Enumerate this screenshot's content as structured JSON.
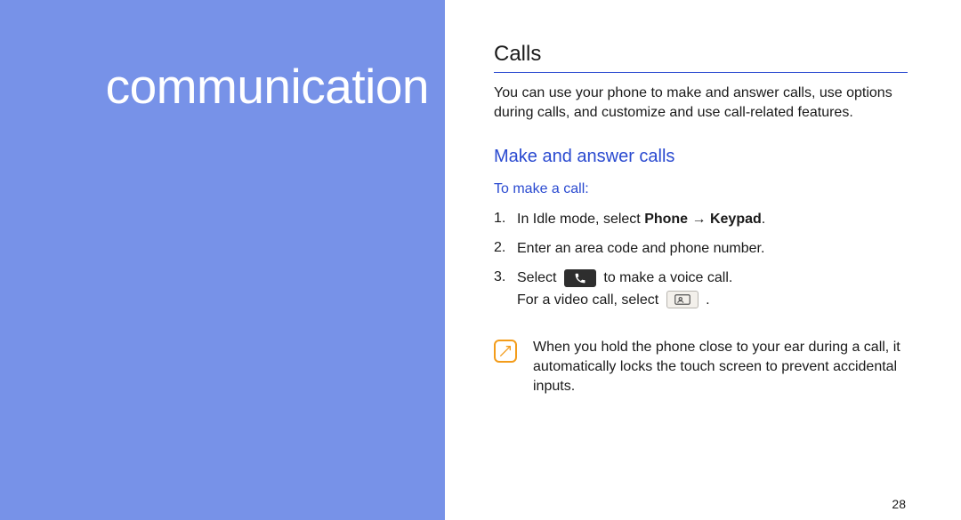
{
  "sidebar": {
    "title": "communication"
  },
  "main": {
    "heading": "Calls",
    "intro": "You can use your phone to make and answer calls, use options during calls, and customize and use call-related features.",
    "sub_heading": "Make and answer calls",
    "sub_sub_heading": "To make a call:",
    "steps": [
      {
        "num": "1.",
        "pre": "In Idle mode, select ",
        "b1": "Phone",
        "arrow": " → ",
        "b2": "Keypad",
        "post": "."
      },
      {
        "num": "2.",
        "text": "Enter an area code and phone number."
      },
      {
        "num": "3.",
        "l1_pre": "Select ",
        "l1_post": " to make a voice call.",
        "l2_pre": "For a video call, select ",
        "l2_post": " ."
      }
    ],
    "note": "When you hold the phone close to your ear during a call, it automatically locks the touch screen to prevent accidental inputs.",
    "page_number": "28"
  }
}
